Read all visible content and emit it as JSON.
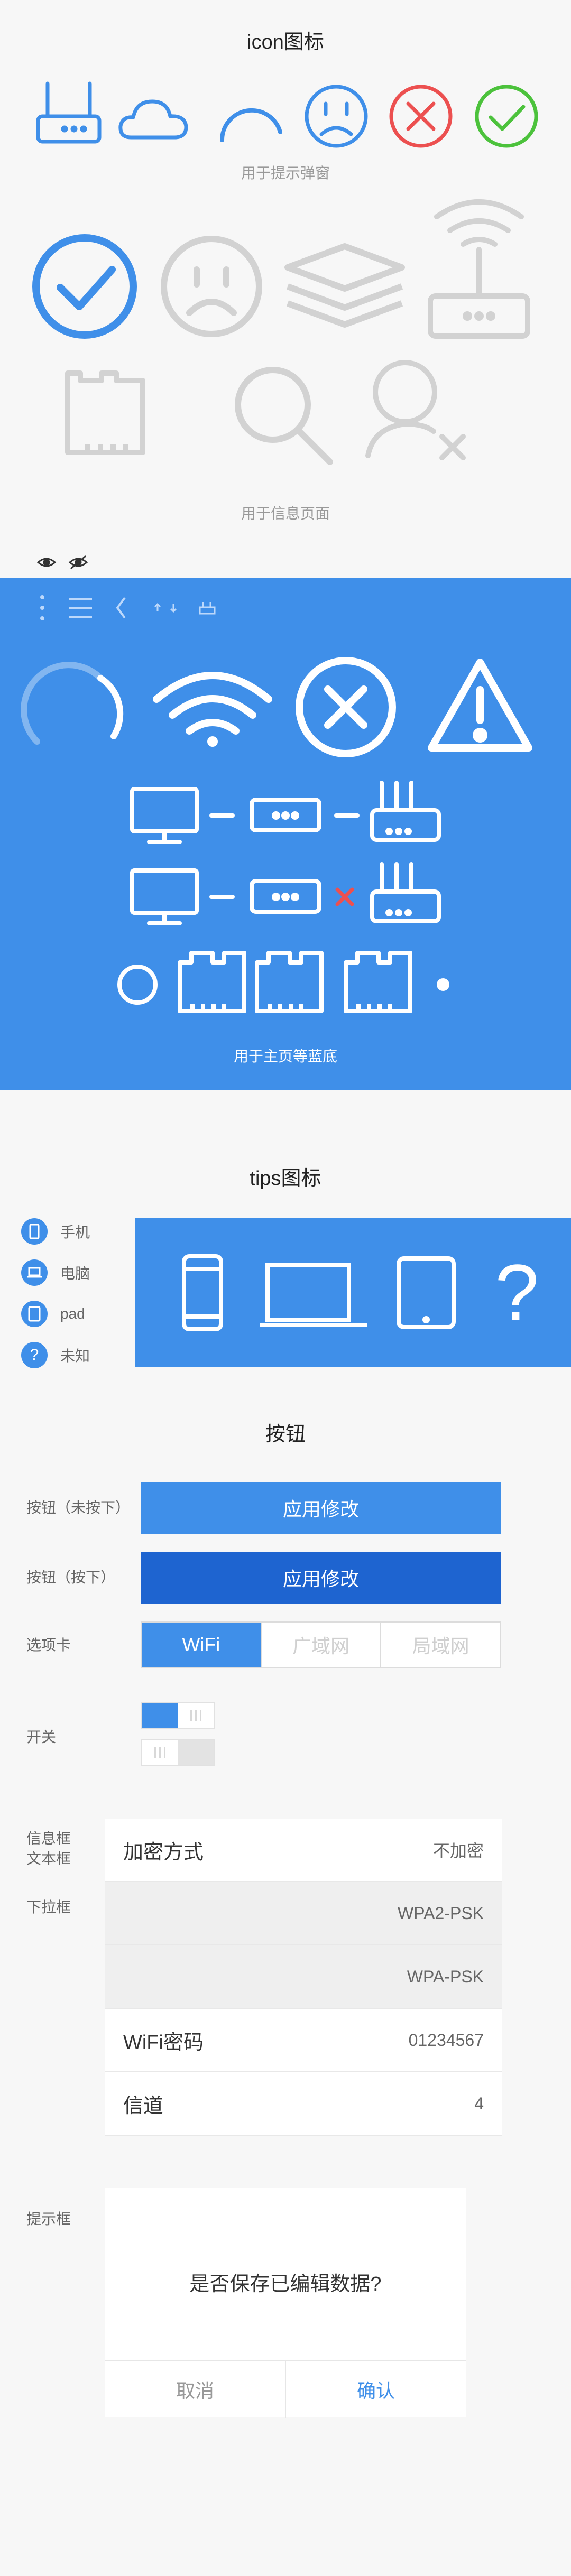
{
  "sections": {
    "icons_title": "icon图标",
    "popup_caption": "用于提示弹窗",
    "info_caption": "用于信息页面",
    "blue_caption": "用于主页等蓝底",
    "tips_title": "tips图标",
    "buttons_title": "按钮"
  },
  "tips": [
    {
      "label": "手机",
      "icon": "phone-icon"
    },
    {
      "label": "电脑",
      "icon": "laptop-icon"
    },
    {
      "label": "pad",
      "icon": "tablet-icon"
    },
    {
      "label": "未知",
      "icon": "question-icon",
      "glyph": "?"
    }
  ],
  "tips_panel_glyph": "?",
  "buttons": {
    "normal_label": "按钮（未按下）",
    "normal_text": "应用修改",
    "pressed_label": "按钮（按下）",
    "pressed_text": "应用修改",
    "tabs_label": "选项卡",
    "tabs": [
      "WiFi",
      "广域网",
      "局域网"
    ],
    "switch_label": "开关",
    "info_label_line1": "信息框",
    "info_label_line2": "文本框",
    "dropdown_label": "下拉框",
    "dialog_label": "提示框"
  },
  "list": {
    "encryption_label": "加密方式",
    "encryption_value": "不加密",
    "options": [
      "WPA2-PSK",
      "WPA-PSK"
    ],
    "wifi_password_label": "WiFi密码",
    "wifi_password_value": "01234567",
    "channel_label": "信道",
    "channel_value": "4"
  },
  "dialog": {
    "message": "是否保存已编辑数据?",
    "cancel": "取消",
    "confirm": "确认"
  },
  "colors": {
    "primary": "#3f8fe9",
    "pressed": "#1e64d0",
    "error": "#ec5050",
    "success": "#4cc23c",
    "gray_icon": "#d2d2d2"
  }
}
